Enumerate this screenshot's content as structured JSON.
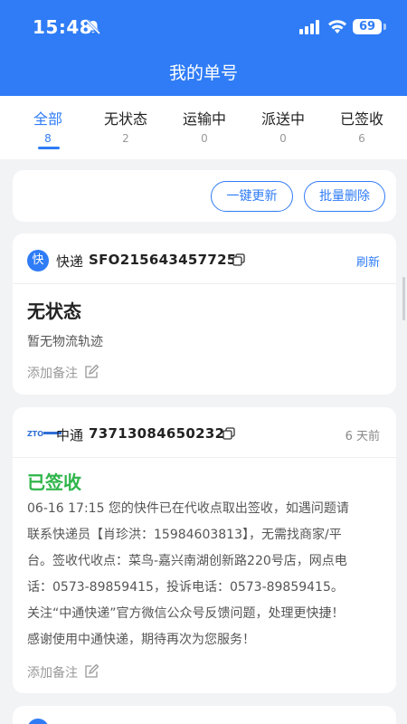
{
  "status_bar": {
    "time": "15:48",
    "battery": "69"
  },
  "header": {
    "title": "我的单号"
  },
  "tabs": [
    {
      "label": "全部",
      "count": "8"
    },
    {
      "label": "无状态",
      "count": "2"
    },
    {
      "label": "运输中",
      "count": "0"
    },
    {
      "label": "派送中",
      "count": "0"
    },
    {
      "label": "已签收",
      "count": "6"
    }
  ],
  "actions": {
    "update_all": "一键更新",
    "batch_delete": "批量删除"
  },
  "shipments": [
    {
      "badge": "快",
      "carrier": "快递",
      "tracking_no": "SFO215643457725",
      "right_text": "刷新",
      "status": "无状态",
      "detail": "暂无物流轨迹",
      "remark": "添加备注"
    },
    {
      "carrier": "中通",
      "tracking_no": "73713084650232",
      "right_text": "6 天前",
      "status": "已签收",
      "detail_lines": [
        "06-16 17:15 您的快件已在代收点取出签收，如遇问题请",
        "联系快递员【肖珍洪：15984603813】，无需找商家/平",
        "台。签收代收点：菜鸟-嘉兴南湖创新路220号店，网点电",
        "话：0573-89859415，投诉电话：0573-89859415。",
        "关注“中通快递”官方微信公众号反馈问题，处理更快捷！",
        "感谢使用中通快递，期待再次为您服务！"
      ],
      "remark": "添加备注"
    }
  ],
  "colors": {
    "primary": "#2f7cf6",
    "signed": "#2fb54a",
    "page_bg": "#f2f3f5"
  }
}
